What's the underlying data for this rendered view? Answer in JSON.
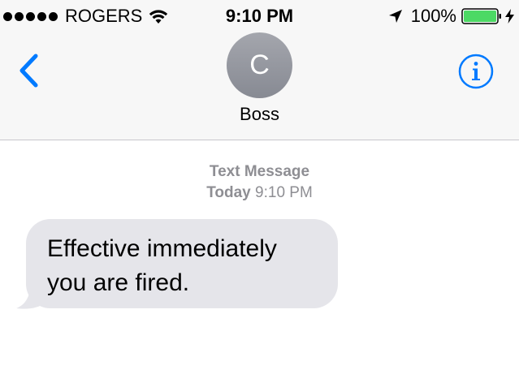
{
  "status_bar": {
    "carrier": "ROGERS",
    "time": "9:10 PM",
    "battery": "100%",
    "icons": [
      "signal-dots",
      "wifi-icon",
      "location-arrow-icon",
      "battery-icon",
      "charging-bolt-icon"
    ]
  },
  "header": {
    "avatar_initial": "C",
    "contact_name": "Boss",
    "back_icon": "chevron-left-icon",
    "info_icon": "info-icon",
    "accent_color": "#007aff"
  },
  "conversation": {
    "service_label": "Text Message",
    "timestamp_day": "Today",
    "timestamp_time": "9:10 PM",
    "messages": [
      {
        "direction": "incoming",
        "text_line1": "Effective immediately",
        "text_line2": "you are fired.",
        "bubble_color": "#e5e5ea"
      }
    ]
  }
}
